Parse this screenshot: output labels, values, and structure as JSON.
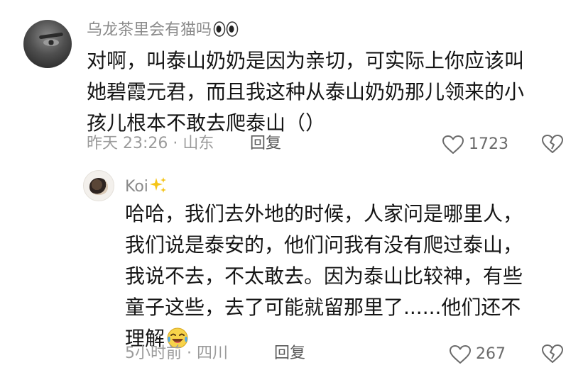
{
  "comment": {
    "username": "乌龙茶里会有猫吗",
    "username_emoji": "eyes-emoji",
    "lines": [
      "对啊，叫泰山奶奶是因为亲切，可实际上你应该叫",
      "她碧霞元君，而且我这种从泰山奶奶那儿领来的小",
      "孩儿根本不敢去爬泰山（）"
    ],
    "meta": "昨天 23:26 · 山东",
    "reply_label": "回复",
    "like_count": "1723"
  },
  "reply": {
    "username": "Koi",
    "username_emoji": "sparkles-emoji",
    "lines": [
      "哈哈，我们去外地的时候，人家问是哪里人，",
      "我们说是泰安的，他们问我有没有爬过泰山，",
      "我说不去，不太敢去。因为泰山比较神，有些",
      "童子这些，去了可能就留那里了......他们还不",
      "理解"
    ],
    "trailing_emoji": "tears-of-joy-emoji",
    "meta": "5小时前 · 四川",
    "reply_label": "回复",
    "like_count": "267"
  },
  "colors": {
    "username": "#8a8a8a",
    "text": "#151515",
    "meta": "#9b9b9b",
    "icon": "#6b6b6b"
  }
}
